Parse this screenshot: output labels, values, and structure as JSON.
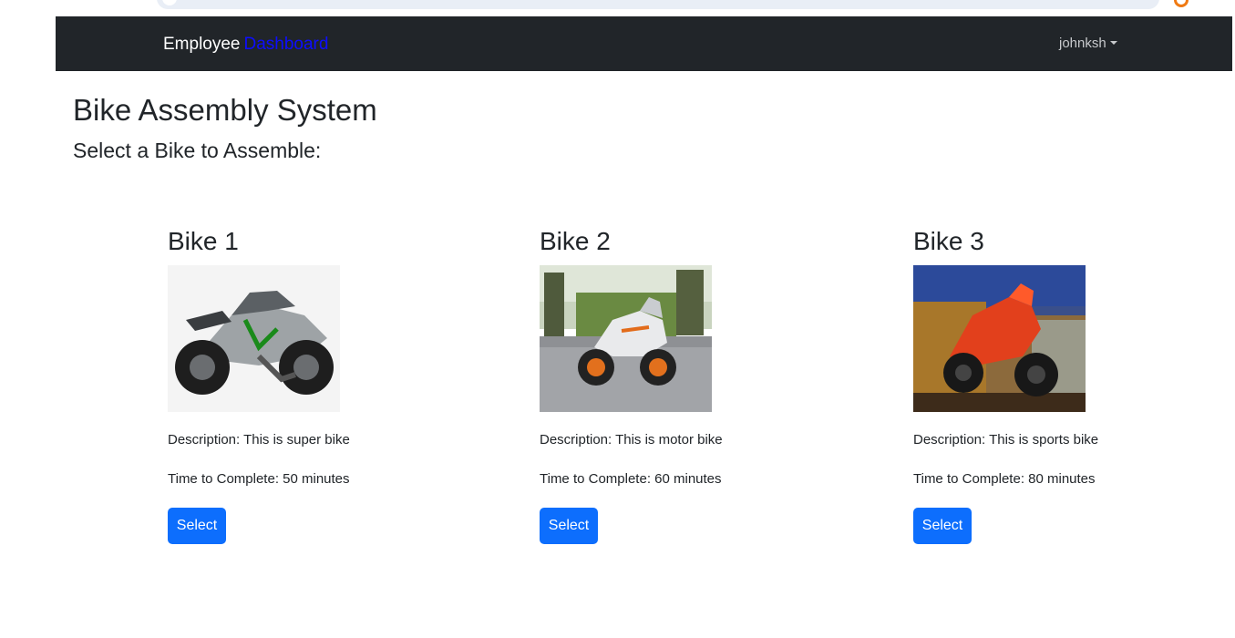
{
  "navbar": {
    "brand_main": "Employee",
    "brand_accent": "Dashboard",
    "user": "johnksh"
  },
  "page": {
    "title": "Bike Assembly System",
    "subtitle": "Select a Bike to Assemble:"
  },
  "bikes": [
    {
      "name": "Bike 1",
      "description": "Description: This is super bike",
      "time": "Time to Complete: 50 minutes",
      "button": "Select"
    },
    {
      "name": "Bike 2",
      "description": "Description: This is motor bike",
      "time": "Time to Complete: 60 minutes",
      "button": "Select"
    },
    {
      "name": "Bike 3",
      "description": "Description: This is sports bike",
      "time": "Time to Complete: 80 minutes",
      "button": "Select"
    }
  ],
  "colors": {
    "navbar_bg": "#212529",
    "primary_button": "#0d6efd",
    "brand_accent": "#0d0dff"
  }
}
